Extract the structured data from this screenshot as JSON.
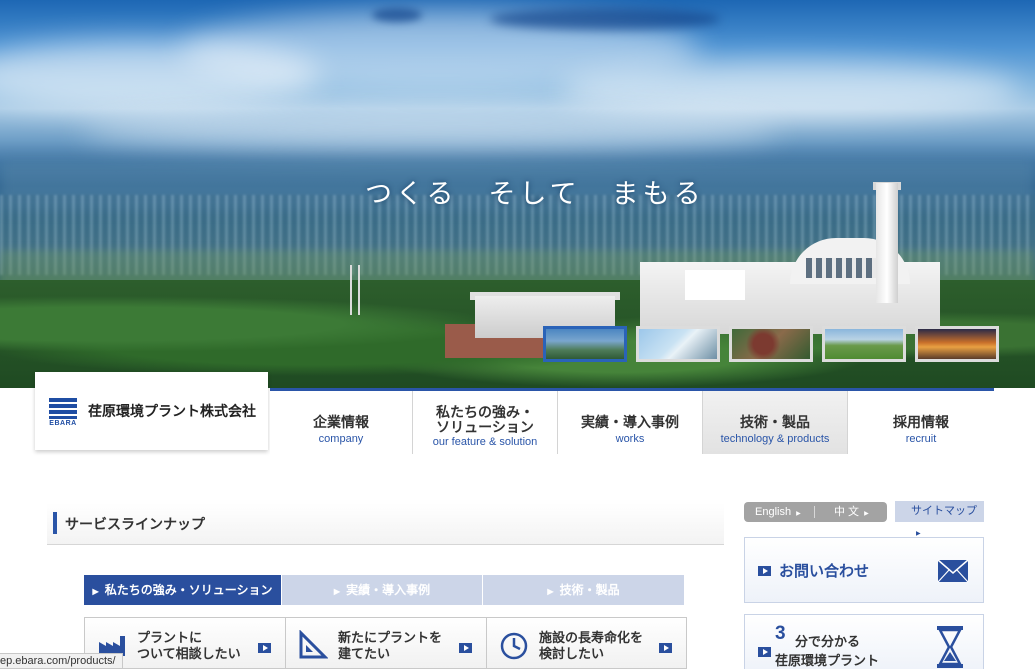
{
  "hero": {
    "slogan": "つくる　そして　まもる",
    "thumbnails": [
      {
        "name": "thumb-plant",
        "active": true
      },
      {
        "name": "thumb-pipes",
        "active": false
      },
      {
        "name": "thumb-machinery",
        "active": false
      },
      {
        "name": "thumb-field",
        "active": false
      },
      {
        "name": "thumb-sunset",
        "active": false
      }
    ]
  },
  "header": {
    "logo_mark_text": "EBARA",
    "company_name": "荏原環境プラント株式会社"
  },
  "global_nav": [
    {
      "jp": "企業情報",
      "en": "company"
    },
    {
      "jp": "私たちの強み・\nソリューション",
      "en": "our feature & solution"
    },
    {
      "jp": "実績・導入事例",
      "en": "works"
    },
    {
      "jp": "技術・製品",
      "en": "technology & products"
    },
    {
      "jp": "採用情報",
      "en": "recruit"
    }
  ],
  "main": {
    "section_title": "サービスラインナップ",
    "tabs": [
      {
        "label": "私たちの強み・ソリューション",
        "active": true
      },
      {
        "label": "実績・導入事例",
        "active": false
      },
      {
        "label": "技術・製品",
        "active": false
      }
    ],
    "cards": [
      {
        "text": "プラントに\nついて相談したい",
        "icon": "factory-icon"
      },
      {
        "text": "新たにプラントを\n建てたい",
        "icon": "triangle-ruler-icon"
      },
      {
        "text": "施設の長寿命化を\n検討したい",
        "icon": "clock-icon"
      }
    ]
  },
  "side": {
    "lang_english": "English",
    "lang_chinese": "中 文",
    "sitemap": "サイトマップ",
    "contact": "お問い合わせ",
    "quick_big": "3",
    "quick_line1": "分で分かる",
    "quick_line2": "荏原環境プラント"
  },
  "status_bar": "ep.ebara.com/products/",
  "colors": {
    "brand_blue": "#2a4f9e",
    "nav_accent": "#2a55a8",
    "tab_inactive": "#ccd5e8"
  }
}
